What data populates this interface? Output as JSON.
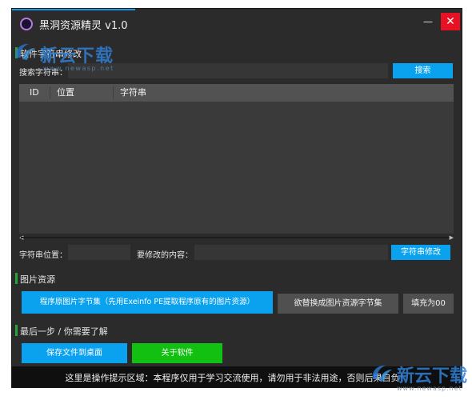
{
  "window": {
    "title": "黑洞资源精灵 v1.0",
    "minimize_glyph": "—",
    "close_glyph": "✕"
  },
  "string_section": {
    "title": "软件字符串修改",
    "search_label": "搜索字符串：",
    "search_value": "",
    "search_button": "搜索",
    "table_headers": [
      "ID",
      "位置",
      "字符串"
    ],
    "rows": [],
    "position_label": "字符串位置：",
    "position_value": "",
    "content_label": "要修改的内容：",
    "content_value": "",
    "modify_button": "字符串修改"
  },
  "image_section": {
    "title": "图片资源",
    "original_bytes_button": "程序原图片字节集（先用Exeinfo PE提取程序原有的图片资源）",
    "replace_bytes_button": "欲替换成图片资源字节集",
    "pad_button": "填充为00"
  },
  "final_section": {
    "title": "最后一步 / 你需要了解",
    "save_button": "保存文件到桌面",
    "about_button": "关于软件"
  },
  "status_text": "这里是操作提示区域：本程序仅用于学习交流使用，请勿用于非法用途，否则后果自负！",
  "watermarks": {
    "top_cn": "新云下载",
    "top_en": "www.newasp.net",
    "bottom_cn": "新云下载",
    "bottom_en": "www.newasp.net"
  },
  "colors": {
    "accent_blue": "#0aa1ef",
    "accent_green": "#12c012",
    "close_red": "#e81123",
    "window_bg": "#2b2b2b"
  },
  "icons": {
    "app": "app-logo-icon",
    "minimize": "minimize-icon",
    "close": "close-icon",
    "scroll_left": "arrow-left-icon",
    "scroll_right": "arrow-right-icon"
  }
}
